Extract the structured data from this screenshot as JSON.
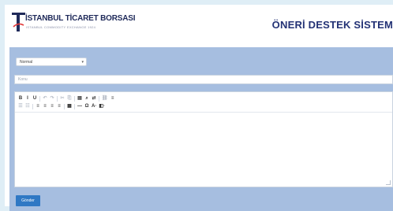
{
  "header": {
    "logo_title": "İSTANBUL TİCARET BORSASI",
    "logo_subtitle": "ISTANBUL COMMODITY EXCHANGE 1924",
    "system_title": "ÖNERİ DESTEK SİSTEM"
  },
  "form": {
    "format_select_value": "Normal",
    "subject_placeholder": "Konu",
    "submit_label": "Gönder"
  },
  "toolbar": {
    "row1": [
      {
        "name": "bold-button",
        "glyph": "B",
        "enabled": true
      },
      {
        "name": "italic-button",
        "glyph": "I",
        "enabled": true
      },
      {
        "name": "underline-button",
        "glyph": "U",
        "enabled": true
      },
      {
        "name": "undo-button",
        "glyph": "↶",
        "enabled": false
      },
      {
        "name": "redo-button",
        "glyph": "↷",
        "enabled": false
      },
      {
        "name": "cut-button",
        "glyph": "✂",
        "enabled": false
      },
      {
        "name": "copy-button",
        "glyph": "⎘",
        "enabled": false
      },
      {
        "name": "paste-button",
        "glyph": "▤",
        "enabled": true
      },
      {
        "name": "find-button",
        "glyph": "⌕",
        "enabled": true
      },
      {
        "name": "replace-button",
        "glyph": "⇄",
        "enabled": true
      },
      {
        "name": "link-button",
        "glyph": "⛓",
        "enabled": false
      },
      {
        "name": "unlink-button",
        "glyph": "≡",
        "enabled": true
      }
    ],
    "row2": [
      {
        "name": "ordered-list-button",
        "glyph": "☰",
        "enabled": false
      },
      {
        "name": "unordered-list-button",
        "glyph": "☷",
        "enabled": false
      },
      {
        "name": "align-left-button",
        "glyph": "≡",
        "enabled": true
      },
      {
        "name": "align-center-button",
        "glyph": "≡",
        "enabled": true
      },
      {
        "name": "align-right-button",
        "glyph": "≡",
        "enabled": true
      },
      {
        "name": "align-justify-button",
        "glyph": "≡",
        "enabled": true
      },
      {
        "name": "table-button",
        "glyph": "▦",
        "enabled": true
      },
      {
        "name": "horizontal-rule-button",
        "glyph": "—",
        "enabled": true
      },
      {
        "name": "special-char-button",
        "glyph": "Ω",
        "enabled": true
      },
      {
        "name": "text-color-button",
        "glyph": "A·",
        "enabled": true
      },
      {
        "name": "background-color-button",
        "glyph": "◧·",
        "enabled": true
      }
    ]
  },
  "colors": {
    "panel": "#a6bee0",
    "submit": "#2f78c4",
    "title": "#233275"
  }
}
